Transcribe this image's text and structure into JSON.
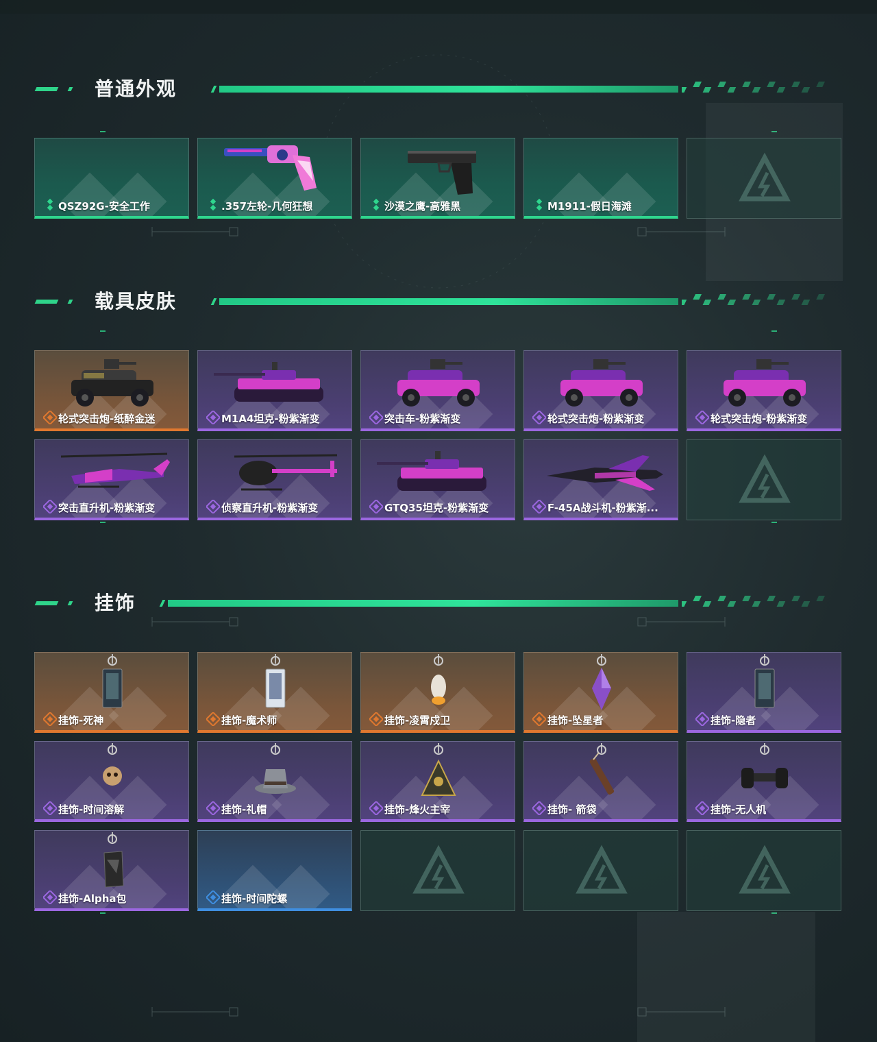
{
  "sections": [
    {
      "title": "普通外观",
      "cards": [
        {
          "label": "QSZ92G-安全工作",
          "rarity": "teal",
          "art": "none"
        },
        {
          "label": ".357左轮-几何狂想",
          "rarity": "teal",
          "art": "revolver"
        },
        {
          "label": "沙漠之鹰-高雅黑",
          "rarity": "teal",
          "art": "pistol"
        },
        {
          "label": "M1911-假日海滩",
          "rarity": "teal",
          "art": "none"
        },
        {
          "label": "",
          "rarity": "empty",
          "art": "logo"
        }
      ]
    },
    {
      "title": "载具皮肤",
      "cards": [
        {
          "label": "轮式突击炮-纸醉金迷",
          "rarity": "orange",
          "art": "armored-car-black"
        },
        {
          "label": "M1A4坦克-粉紫渐变",
          "rarity": "purple",
          "art": "tank"
        },
        {
          "label": "突击车-粉紫渐变",
          "rarity": "purple",
          "art": "assault-car"
        },
        {
          "label": "轮式突击炮-粉紫渐变",
          "rarity": "purple",
          "art": "armored-car"
        },
        {
          "label": "轮式突击炮-粉紫渐变",
          "rarity": "purple",
          "art": "armored-car"
        },
        {
          "label": "突击直升机-粉紫渐变",
          "rarity": "purple",
          "art": "attack-heli"
        },
        {
          "label": "侦察直升机-粉紫渐变",
          "rarity": "purple",
          "art": "scout-heli"
        },
        {
          "label": "GTQ35坦克-粉紫渐变",
          "rarity": "purple",
          "art": "tank"
        },
        {
          "label": "F-45A战斗机-粉紫渐...",
          "rarity": "purple",
          "art": "jet"
        },
        {
          "label": "",
          "rarity": "empty",
          "art": "logo"
        }
      ]
    },
    {
      "title": "挂饰",
      "cards": [
        {
          "label": "挂饰-死神",
          "rarity": "orange",
          "art": "charm-card"
        },
        {
          "label": "挂饰-魔术师",
          "rarity": "orange",
          "art": "charm-card-light"
        },
        {
          "label": "挂饰-凌霄戍卫",
          "rarity": "orange",
          "art": "charm-bird"
        },
        {
          "label": "挂饰-坠星者",
          "rarity": "orange",
          "art": "charm-crystal"
        },
        {
          "label": "挂饰-隐者",
          "rarity": "purple",
          "art": "charm-card"
        },
        {
          "label": "挂饰-时间溶解",
          "rarity": "purple",
          "art": "charm-skull"
        },
        {
          "label": "挂饰-礼帽",
          "rarity": "purple",
          "art": "charm-hat"
        },
        {
          "label": "挂饰-烽火主宰",
          "rarity": "purple",
          "art": "charm-triangle"
        },
        {
          "label": "挂饰- 箭袋",
          "rarity": "purple",
          "art": "charm-quiver"
        },
        {
          "label": "挂饰-无人机",
          "rarity": "purple",
          "art": "charm-drone"
        },
        {
          "label": "挂饰-Alpha包",
          "rarity": "purple",
          "art": "charm-bag"
        },
        {
          "label": "挂饰-时间陀螺",
          "rarity": "blue",
          "art": "none"
        },
        {
          "label": "",
          "rarity": "empty",
          "art": "logo"
        },
        {
          "label": "",
          "rarity": "empty",
          "art": "logo"
        },
        {
          "label": "",
          "rarity": "empty",
          "art": "logo"
        }
      ]
    }
  ],
  "colors": {
    "accent": "#2fd48a",
    "teal": "#2fd68e",
    "orange": "#e0782f",
    "purple": "#9b67e0",
    "blue": "#3f8ee0"
  }
}
